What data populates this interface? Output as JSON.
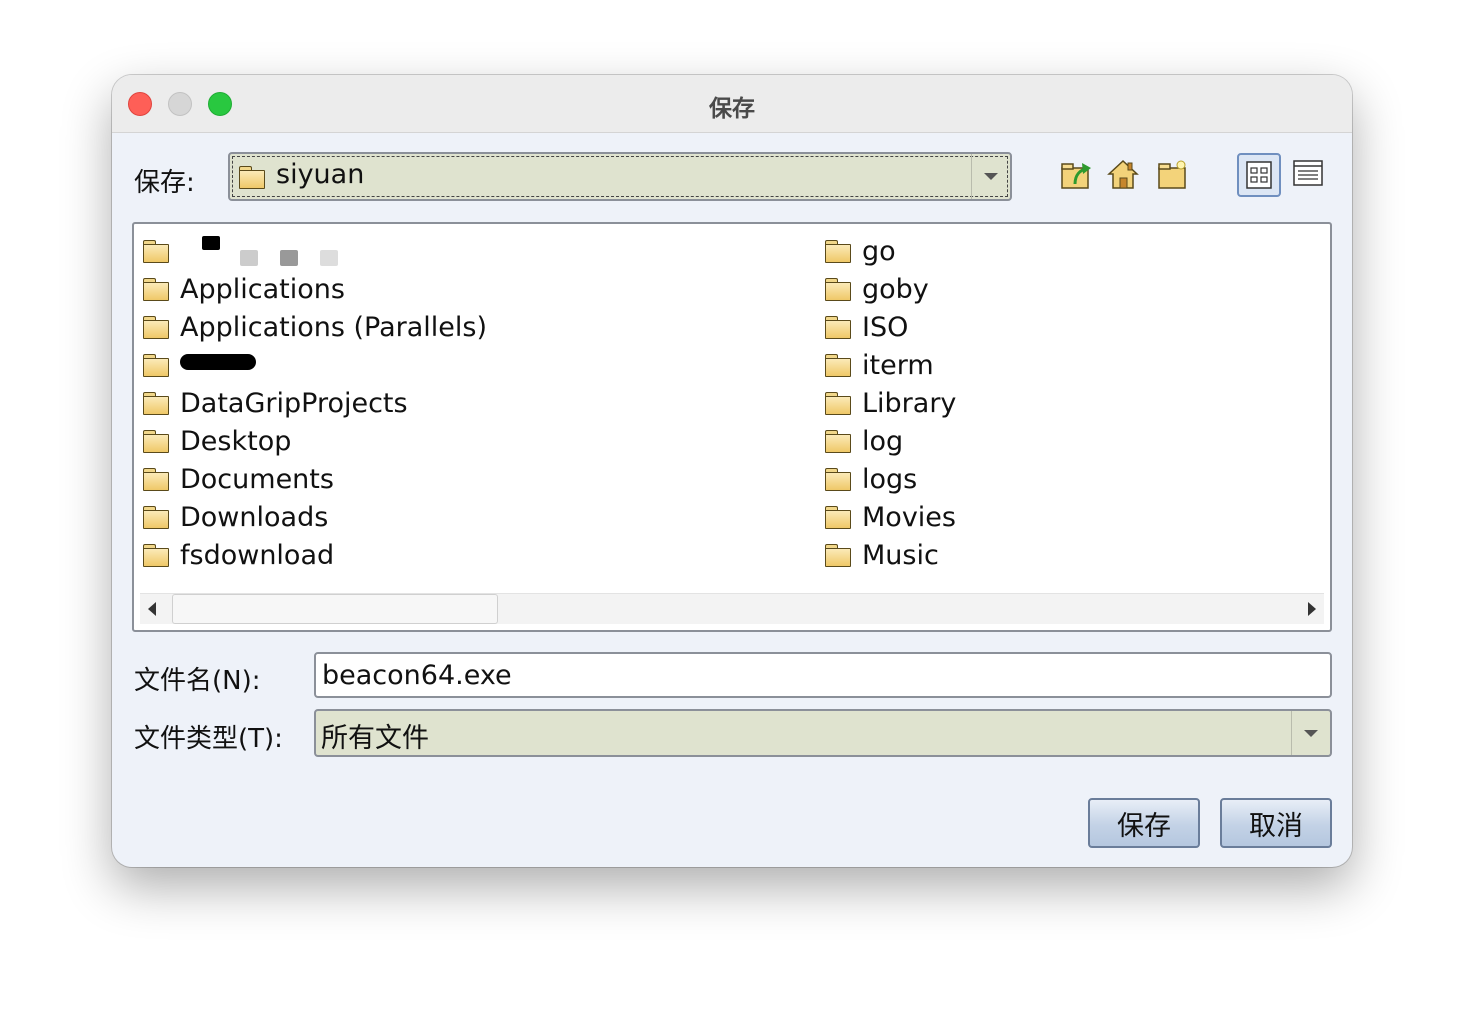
{
  "window": {
    "title": "保存"
  },
  "save_in": {
    "label": "保存:",
    "current_folder": "siyuan"
  },
  "toolbar": {
    "icons": [
      "up-folder-icon",
      "home-icon",
      "new-folder-icon",
      "list-view-icon",
      "details-view-icon"
    ],
    "active_view": "list"
  },
  "files": {
    "left": [
      {
        "name": "",
        "redacted": true
      },
      {
        "name": "Applications"
      },
      {
        "name": "Applications (Parallels)"
      },
      {
        "name": "",
        "redacted": true
      },
      {
        "name": "DataGripProjects"
      },
      {
        "name": "Desktop"
      },
      {
        "name": "Documents"
      },
      {
        "name": "Downloads"
      },
      {
        "name": "fsdownload"
      }
    ],
    "right": [
      {
        "name": "go"
      },
      {
        "name": "goby"
      },
      {
        "name": "ISO"
      },
      {
        "name": "iterm"
      },
      {
        "name": "Library"
      },
      {
        "name": "log"
      },
      {
        "name": "logs"
      },
      {
        "name": "Movies"
      },
      {
        "name": "Music"
      }
    ]
  },
  "filename": {
    "label": "文件名(N):",
    "value": "beacon64.exe"
  },
  "filetype": {
    "label": "文件类型(T):",
    "value": "所有文件"
  },
  "buttons": {
    "save": "保存",
    "cancel": "取消"
  },
  "colors": {
    "combo_bg": "#dfe3cf",
    "window_bg": "#eef2f9",
    "button_blue": "#c3d2e6"
  }
}
